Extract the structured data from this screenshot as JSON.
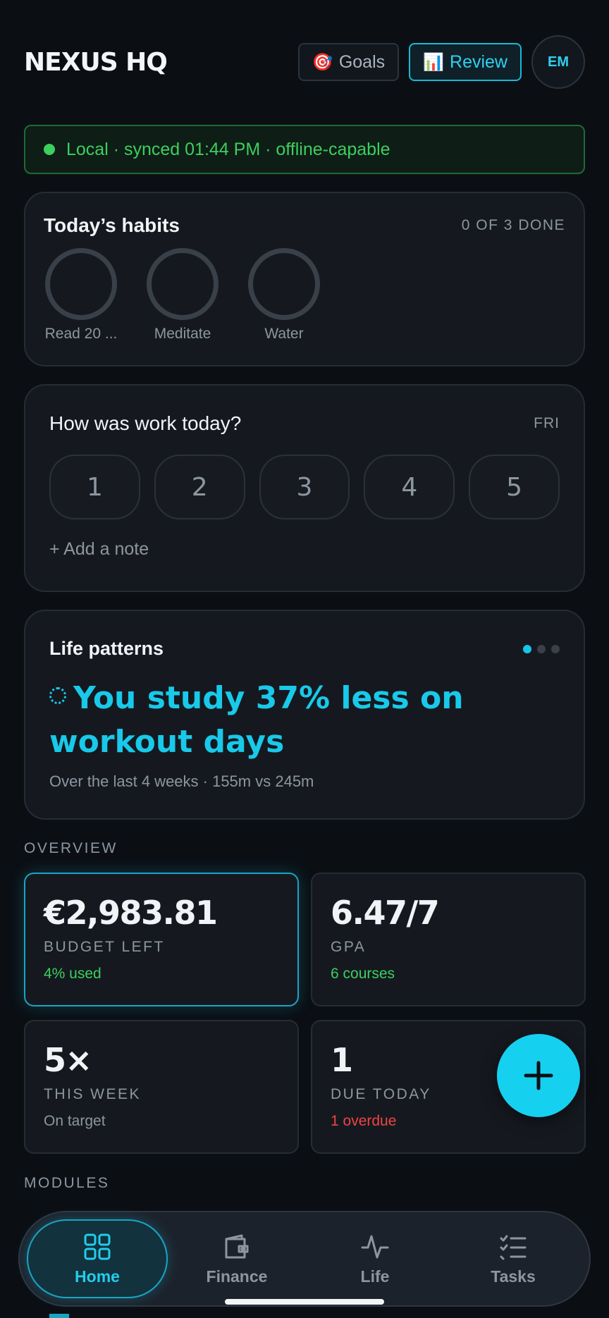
{
  "header": {
    "brand": "NEXUS HQ",
    "goals_icon": "🎯",
    "goals_label": "Goals",
    "review_icon": "📊",
    "review_label": "Review",
    "avatar_initials": "EM"
  },
  "sync": {
    "text": "Local · synced 01:44 PM · offline-capable",
    "color": "#3ccf5e"
  },
  "habits": {
    "title": "Today’s habits",
    "status": "0 OF 3 DONE",
    "items": [
      {
        "label": "Read 20 ...",
        "done": false
      },
      {
        "label": "Meditate",
        "done": false
      },
      {
        "label": "Water",
        "done": false
      }
    ]
  },
  "work": {
    "title": "How was work today?",
    "day": "FRI",
    "ratings": [
      "1",
      "2",
      "3",
      "4",
      "5"
    ],
    "add_note": "+ Add a note"
  },
  "patterns": {
    "title": "Life patterns",
    "insight": "You study 37% less on workout days",
    "detail": "Over the last 4 weeks · 155m vs 245m",
    "page_count": 3,
    "active_page": 1
  },
  "overview": {
    "label": "OVERVIEW",
    "stats": [
      {
        "value": "€2,983.81",
        "label": "BUDGET LEFT",
        "sub": "4% used",
        "sub_color": "green"
      },
      {
        "value": "6.47/7",
        "label": "GPA",
        "sub": "6 courses",
        "sub_color": "green"
      },
      {
        "value": "5×",
        "label": "THIS WEEK",
        "sub": "On target",
        "sub_color": "grey"
      },
      {
        "value": "1",
        "label": "DUE TODAY",
        "sub": "1 overdue",
        "sub_color": "red"
      }
    ]
  },
  "modules": {
    "label": "MODULES"
  },
  "nav": {
    "items": [
      {
        "label": "Home",
        "icon": "grid-icon",
        "active": true
      },
      {
        "label": "Finance",
        "icon": "wallet-icon",
        "active": false
      },
      {
        "label": "Life",
        "icon": "pulse-icon",
        "active": false
      },
      {
        "label": "Tasks",
        "icon": "checklist-icon",
        "active": false
      }
    ]
  },
  "colors": {
    "accent": "#19c9ea",
    "background": "#0b0f14",
    "card": "#15191f",
    "success": "#3ccf5e",
    "danger": "#ef4444"
  }
}
